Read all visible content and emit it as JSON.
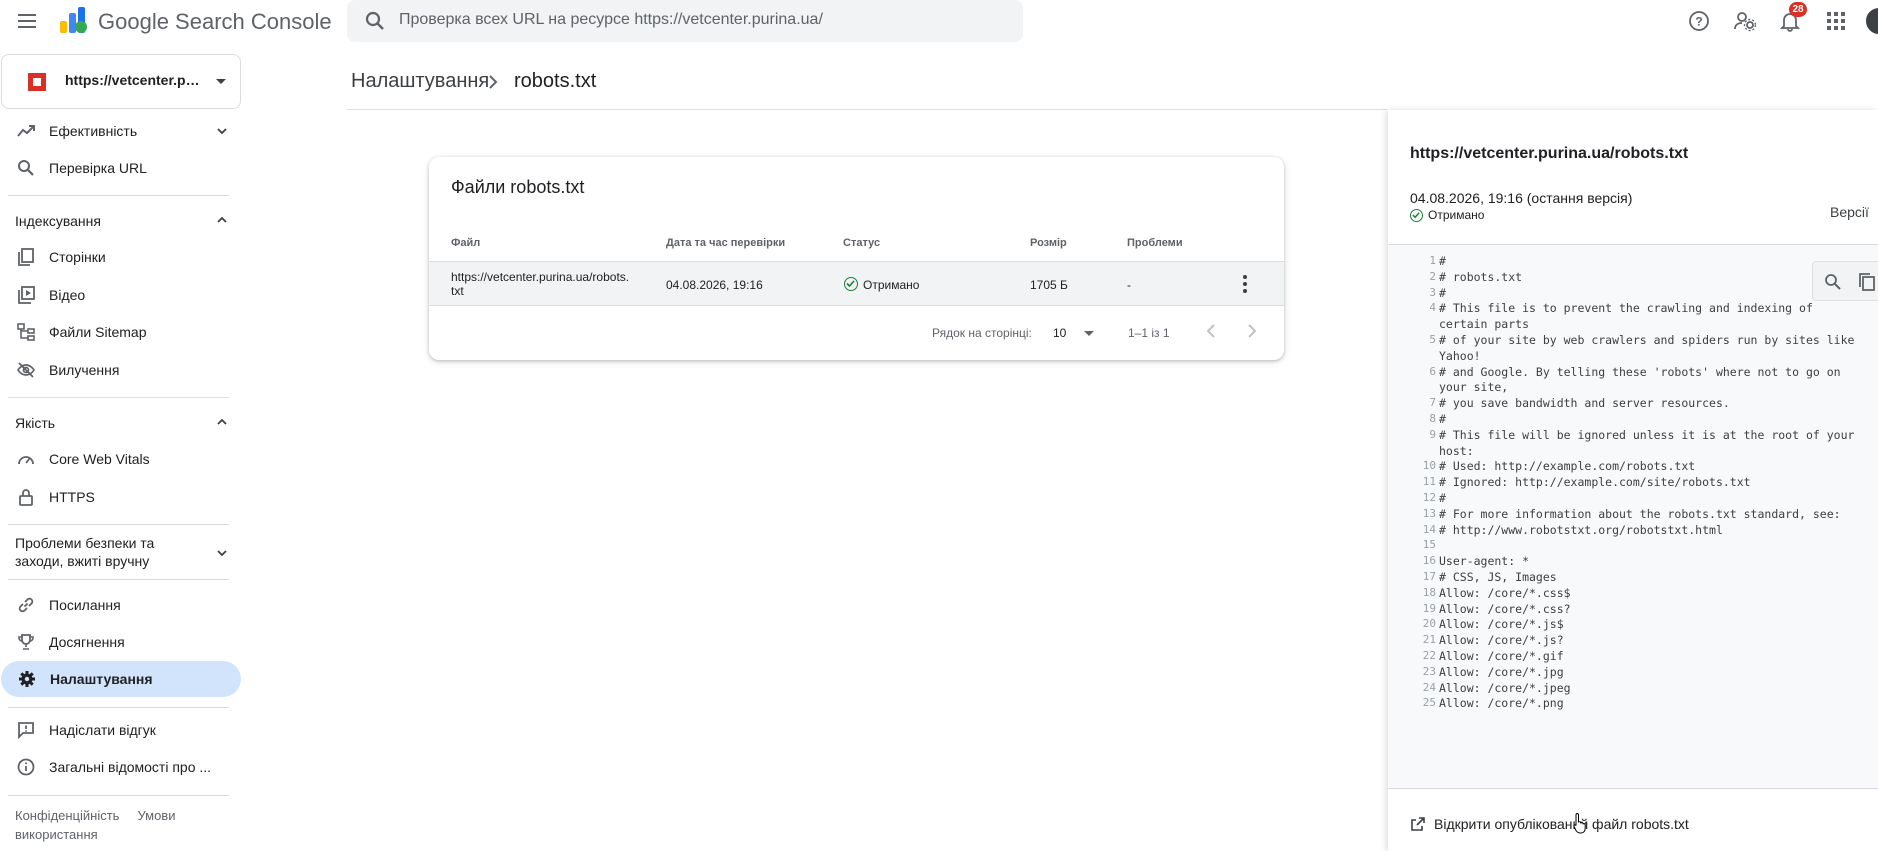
{
  "app": {
    "title": "Google Search Console"
  },
  "search": {
    "placeholder": "Проверка всех URL на ресурсе https://vetcenter.purina.ua/"
  },
  "topbar": {
    "notifications_count": "28"
  },
  "property": {
    "label": "https://vetcenter.puri..."
  },
  "sidebar": {
    "performance": "Ефективність",
    "url_inspection": "Перевірка URL",
    "indexing_section": "Індексування",
    "pages": "Сторінки",
    "video": "Відео",
    "sitemaps": "Файли Sitemap",
    "removals": "Вилучення",
    "quality_section": "Якість",
    "core_web_vitals": "Core Web Vitals",
    "https": "HTTPS",
    "security_section": "Проблеми безпеки та заходи, вжиті вручну",
    "links": "Посилання",
    "achievements": "Досягнення",
    "settings": "Налаштування",
    "feedback": "Надіслати відгук",
    "about": "Загальні відомості про ...",
    "privacy": "Конфіденційність",
    "terms": "Умови використання"
  },
  "breadcrumb": {
    "parent": "Налаштування",
    "current": "robots.txt"
  },
  "card": {
    "title": "Файли robots.txt",
    "columns": [
      "Файл",
      "Дата та час перевірки",
      "Статус",
      "Розмір",
      "Проблеми"
    ],
    "rows": [
      {
        "file": "https://vetcenter.purina.ua/robots.txt",
        "checked": "04.08.2026, 19:16",
        "status": "Отримано",
        "size": "1705 Б",
        "issues": "-"
      }
    ],
    "pager": {
      "rows_per_page_label": "Рядок на сторінці:",
      "rows_per_page": "10",
      "range": "1–1 із 1"
    }
  },
  "panel": {
    "url": "https://vetcenter.purina.ua/robots.txt",
    "date": "04.08.2026, 19:16 (остання версія)",
    "status": "Отримано",
    "versions": "Версії",
    "open_link": "Відкрити опублікований файл robots.txt",
    "code_lines": [
      {
        "n": "1",
        "t": [
          "#"
        ]
      },
      {
        "n": "2",
        "t": [
          "# robots.txt"
        ]
      },
      {
        "n": "3",
        "t": [
          "#"
        ]
      },
      {
        "n": "4",
        "t": [
          "# This file is to prevent the crawling and indexing of",
          "certain parts"
        ]
      },
      {
        "n": "5",
        "t": [
          "# of your site by web crawlers and spiders run by sites like",
          "Yahoo!"
        ]
      },
      {
        "n": "6",
        "t": [
          "# and Google. By telling these 'robots' where not to go on",
          "your site,"
        ]
      },
      {
        "n": "7",
        "t": [
          "# you save bandwidth and server resources."
        ]
      },
      {
        "n": "8",
        "t": [
          "#"
        ]
      },
      {
        "n": "9",
        "t": [
          "# This file will be ignored unless it is at the root of your",
          "host:"
        ]
      },
      {
        "n": "10",
        "t": [
          "# Used:    http://example.com/robots.txt"
        ]
      },
      {
        "n": "11",
        "t": [
          "# Ignored: http://example.com/site/robots.txt"
        ]
      },
      {
        "n": "12",
        "t": [
          "#"
        ]
      },
      {
        "n": "13",
        "t": [
          "# For more information about the robots.txt standard, see:"
        ]
      },
      {
        "n": "14",
        "t": [
          "# http://www.robotstxt.org/robotstxt.html"
        ]
      },
      {
        "n": "15",
        "t": [
          ""
        ]
      },
      {
        "n": "16",
        "t": [
          "User-agent: *"
        ]
      },
      {
        "n": "17",
        "t": [
          "# CSS, JS, Images"
        ]
      },
      {
        "n": "18",
        "t": [
          "Allow: /core/*.css$"
        ]
      },
      {
        "n": "19",
        "t": [
          "Allow: /core/*.css?"
        ]
      },
      {
        "n": "20",
        "t": [
          "Allow: /core/*.js$"
        ]
      },
      {
        "n": "21",
        "t": [
          "Allow: /core/*.js?"
        ]
      },
      {
        "n": "22",
        "t": [
          "Allow: /core/*.gif"
        ]
      },
      {
        "n": "23",
        "t": [
          "Allow: /core/*.jpg"
        ]
      },
      {
        "n": "24",
        "t": [
          "Allow: /core/*.jpeg"
        ]
      },
      {
        "n": "25",
        "t": [
          "Allow: /core/*.png"
        ]
      }
    ]
  },
  "colors": {
    "accent_active": "#d2e3fc",
    "status_ok": "#188038",
    "badge": "#d93025"
  },
  "icons": [
    "menu-icon",
    "search-console-logo",
    "search-icon",
    "help-icon",
    "admin-settings-icon",
    "notifications-icon",
    "apps-grid-icon",
    "performance-icon",
    "url-inspection-icon",
    "pages-icon",
    "video-icon",
    "sitemap-icon",
    "removals-icon",
    "core-web-vitals-icon",
    "lock-icon",
    "links-icon",
    "trophy-icon",
    "gear-icon",
    "feedback-icon",
    "info-icon",
    "status-ok-icon",
    "more-vert-icon",
    "copy-icon",
    "open-in-new-icon"
  ]
}
